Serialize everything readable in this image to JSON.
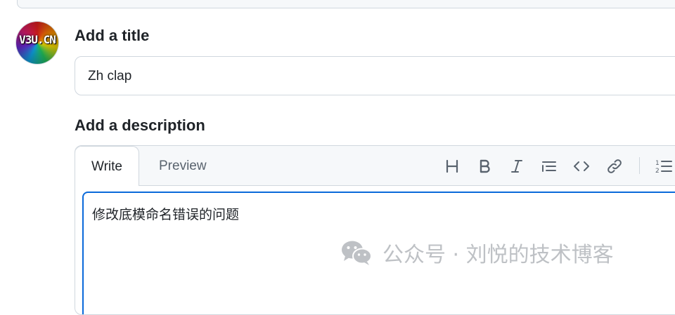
{
  "avatar": {
    "text": "V3U.CN"
  },
  "title_section": {
    "label": "Add a title",
    "value": "Zh clap"
  },
  "description_section": {
    "label": "Add a description",
    "tabs": [
      {
        "label": "Write",
        "active": true
      },
      {
        "label": "Preview",
        "active": false
      }
    ],
    "toolbar": [
      "heading-icon",
      "bold-icon",
      "italic-icon",
      "quote-icon",
      "code-icon",
      "link-icon",
      "ordered-list-icon"
    ],
    "text": "修改底模命名错误的问题"
  },
  "watermark": {
    "text": "公众号 · 刘悦的技术博客"
  },
  "colors": {
    "accent": "#0969da",
    "border": "#d0d7de",
    "header_bg": "#f6f8fa",
    "text": "#1f2328",
    "muted": "#59636e"
  }
}
